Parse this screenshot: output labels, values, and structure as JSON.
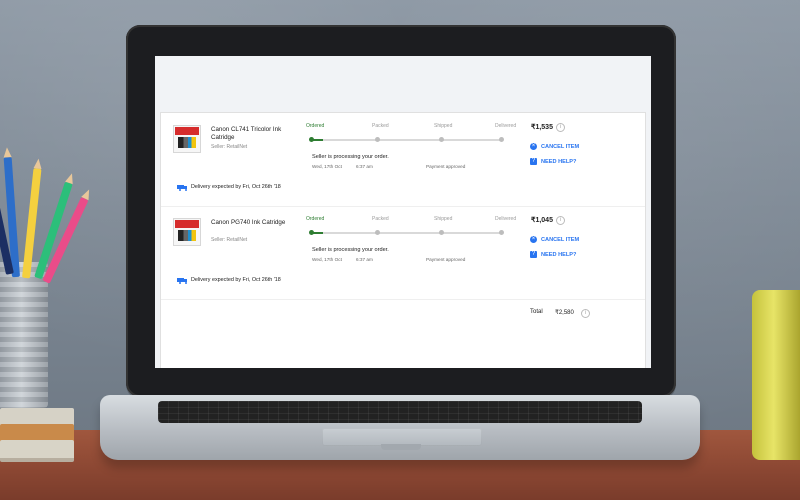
{
  "orders": [
    {
      "product_name": "Canon CL741 Tricolor Ink Catridge",
      "seller": "Seller: RetailNet",
      "delivery": "Delivery expected by Fri, Oct 26th '18",
      "status_steps": [
        "Ordered",
        "Packed",
        "Shipped",
        "Delivered"
      ],
      "processing_text": "Seller is processing your order.",
      "date": "Wed, 17th Oct",
      "time": "6:37 am",
      "payment": "Payment approved",
      "price": "₹1,535",
      "actions": [
        "CANCEL ITEM",
        "NEED HELP?"
      ]
    },
    {
      "product_name": "Canon PG740 Ink Catridge",
      "seller": "Seller: RetailNet",
      "delivery": "Delivery expected by Fri, Oct 26th '18",
      "status_steps": [
        "Ordered",
        "Packed",
        "Shipped",
        "Delivered"
      ],
      "processing_text": "Seller is processing your order.",
      "date": "Wed, 17th Oct",
      "time": "6:37 am",
      "payment": "Payment approved",
      "price": "₹1,045",
      "actions": [
        "CANCEL ITEM",
        "NEED HELP?"
      ]
    }
  ],
  "total": {
    "label": "Total",
    "value": "₹2,580",
    "info_icon": "i"
  },
  "icons": {
    "info": "info-icon",
    "cancel": "cancel-icon",
    "help": "help-icon",
    "truck": "truck-icon"
  },
  "colors": {
    "link_blue": "#2874f0",
    "success_green": "#2e7d32"
  }
}
